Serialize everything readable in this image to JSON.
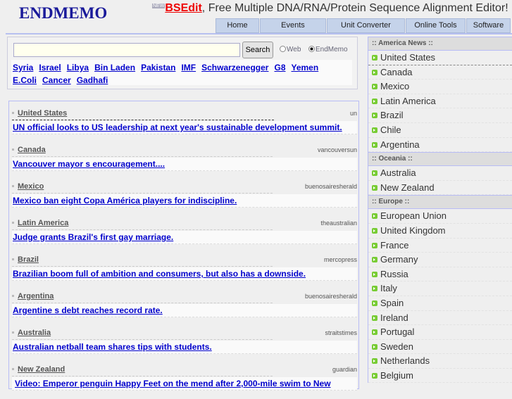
{
  "logo": "ENDMEMO",
  "banner": {
    "badge": "NEW",
    "product": "BSEdit",
    "text": ", Free Multiple DNA/RNA/Protein Sequence Alignment Editor!"
  },
  "nav": [
    "Home",
    "Events",
    "Unit Converter",
    "Online Tools",
    "Software"
  ],
  "search": {
    "value": "",
    "button": "Search",
    "radio_web": "Web",
    "radio_endmemo": "EndMemo",
    "selected": "EndMemo"
  },
  "tags": [
    "Syria",
    "Israel",
    "Libya",
    "Bin Laden",
    "Pakistan",
    "IMF",
    "Schwarzenegger",
    "G8",
    "Yemen",
    "E.Coli",
    "Cancer",
    "Gadhafi"
  ],
  "news": [
    {
      "category": "United States",
      "source": "un",
      "headline": "UN official looks to US leadership at next year's sustainable development summit."
    },
    {
      "category": "Canada",
      "source": "vancouversun",
      "headline": "Vancouver mayor s encouragement...."
    },
    {
      "category": "Mexico",
      "source": "buenosairesherald",
      "headline": "Mexico ban eight Copa América players for indiscipline."
    },
    {
      "category": "Latin America",
      "source": "theaustralian",
      "headline": "Judge grants Brazil's first gay marriage."
    },
    {
      "category": "Brazil",
      "source": "mercopress",
      "headline": "Brazilian boom full of ambition and consumers, but also has a downside."
    },
    {
      "category": "Argentina",
      "source": "buenosairesherald",
      "headline": "Argentine s debt reaches record rate."
    },
    {
      "category": "Australia",
      "source": "straitstimes",
      "headline": "Australian netball team shares tips with students."
    },
    {
      "category": "New Zealand",
      "source": "guardian",
      "headline": "Video: Emperor penguin Happy Feet on the mend after 2,000-mile swim to New"
    }
  ],
  "sidebar": {
    "america_header": ":: America News ::",
    "america": [
      "United States",
      "Canada",
      "Mexico",
      "Latin America",
      "Brazil",
      "Chile",
      "Argentina"
    ],
    "oceania_header": ":: Oceania ::",
    "oceania": [
      "Australia",
      "New Zealand"
    ],
    "europe_header": ":: Europe ::",
    "europe": [
      "European Union",
      "United Kingdom",
      "France",
      "Germany",
      "Russia",
      "Italy",
      "Spain",
      "Ireland",
      "Portugal",
      "Sweden",
      "Netherlands",
      "Belgium"
    ]
  }
}
